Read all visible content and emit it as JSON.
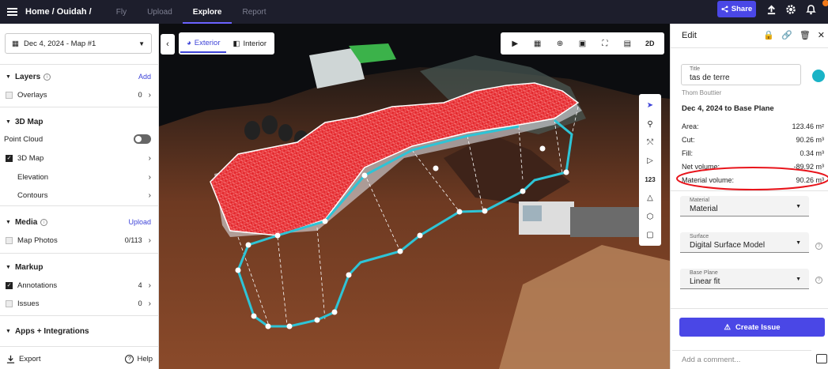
{
  "topbar": {
    "breadcrumb": "Home / Ouidah /",
    "tabs": [
      {
        "label": "Fly",
        "active": false
      },
      {
        "label": "Upload",
        "active": false
      },
      {
        "label": "Explore",
        "active": true
      },
      {
        "label": "Report",
        "active": false
      }
    ],
    "share_label": "Share",
    "icons": [
      "menu-icon",
      "upload-icon",
      "gear-icon",
      "bell-icon"
    ]
  },
  "left_panel": {
    "map_select": "Dec 4, 2024 - Map #1",
    "layers": {
      "title": "Layers",
      "action": "Add",
      "overlays_label": "Overlays",
      "overlays_count": "0"
    },
    "map3d": {
      "title": "3D Map",
      "point_cloud_label": "Point Cloud",
      "point_cloud_on": false,
      "items": [
        {
          "label": "3D Map",
          "checked": true
        },
        {
          "label": "Elevation",
          "checked": false
        },
        {
          "label": "Contours",
          "checked": false
        }
      ]
    },
    "media": {
      "title": "Media",
      "action": "Upload",
      "photos_label": "Map Photos",
      "photos_count": "0/113"
    },
    "markup": {
      "title": "Markup",
      "annotations_label": "Annotations",
      "annotations_count": "4",
      "issues_label": "Issues",
      "issues_count": "0"
    },
    "apps_title": "Apps + Integrations",
    "export_label": "Export",
    "help_label": "Help"
  },
  "viewport": {
    "view_tabs": [
      {
        "label": "Exterior",
        "active": true
      },
      {
        "label": "Interior",
        "active": false
      }
    ],
    "toolbar_icons": [
      "play-icon",
      "clapper-icon",
      "zoom-in-icon",
      "picture-in-picture-icon",
      "fit-view-icon",
      "hd-icon",
      "2d-icon"
    ],
    "toolbar_2d_label": "2D",
    "side_tools": [
      "pointer-icon",
      "pin-icon",
      "ruler-icon",
      "polyline-icon",
      "count-icon",
      "volume-icon",
      "cube-icon",
      "area-icon"
    ],
    "count_label": "123"
  },
  "right_panel": {
    "header": "Edit",
    "header_icons": [
      "lock-icon",
      "link-icon",
      "trash-icon",
      "close-icon"
    ],
    "title_field": {
      "label": "Title",
      "value": "tas de terre"
    },
    "color": "#1ab3c6",
    "author": "Thom Bouttier",
    "measure_title": "Dec 4, 2024 to Base Plane",
    "metrics": [
      {
        "label": "Area:",
        "value": "123.46 m²"
      },
      {
        "label": "Cut:",
        "value": "90.26 m³"
      },
      {
        "label": "Fill:",
        "value": "0.34 m³"
      },
      {
        "label": "Net volume:",
        "value": "-89.92 m³"
      },
      {
        "label": "Material volume:",
        "value": "90.26 m³"
      }
    ],
    "material": {
      "label": "Material",
      "value": "Material"
    },
    "surface": {
      "label": "Surface",
      "value": "Digital Surface Model"
    },
    "base_plane": {
      "label": "Base Plane",
      "value": "Linear fit"
    },
    "create_issue_label": "Create Issue",
    "comment_placeholder": "Add a comment..."
  },
  "colors": {
    "accent": "#4a47e6",
    "topbar": "#1d1e2c",
    "annotation_red": "#e8141b",
    "polygon_cyan": "#2ec4d6"
  }
}
